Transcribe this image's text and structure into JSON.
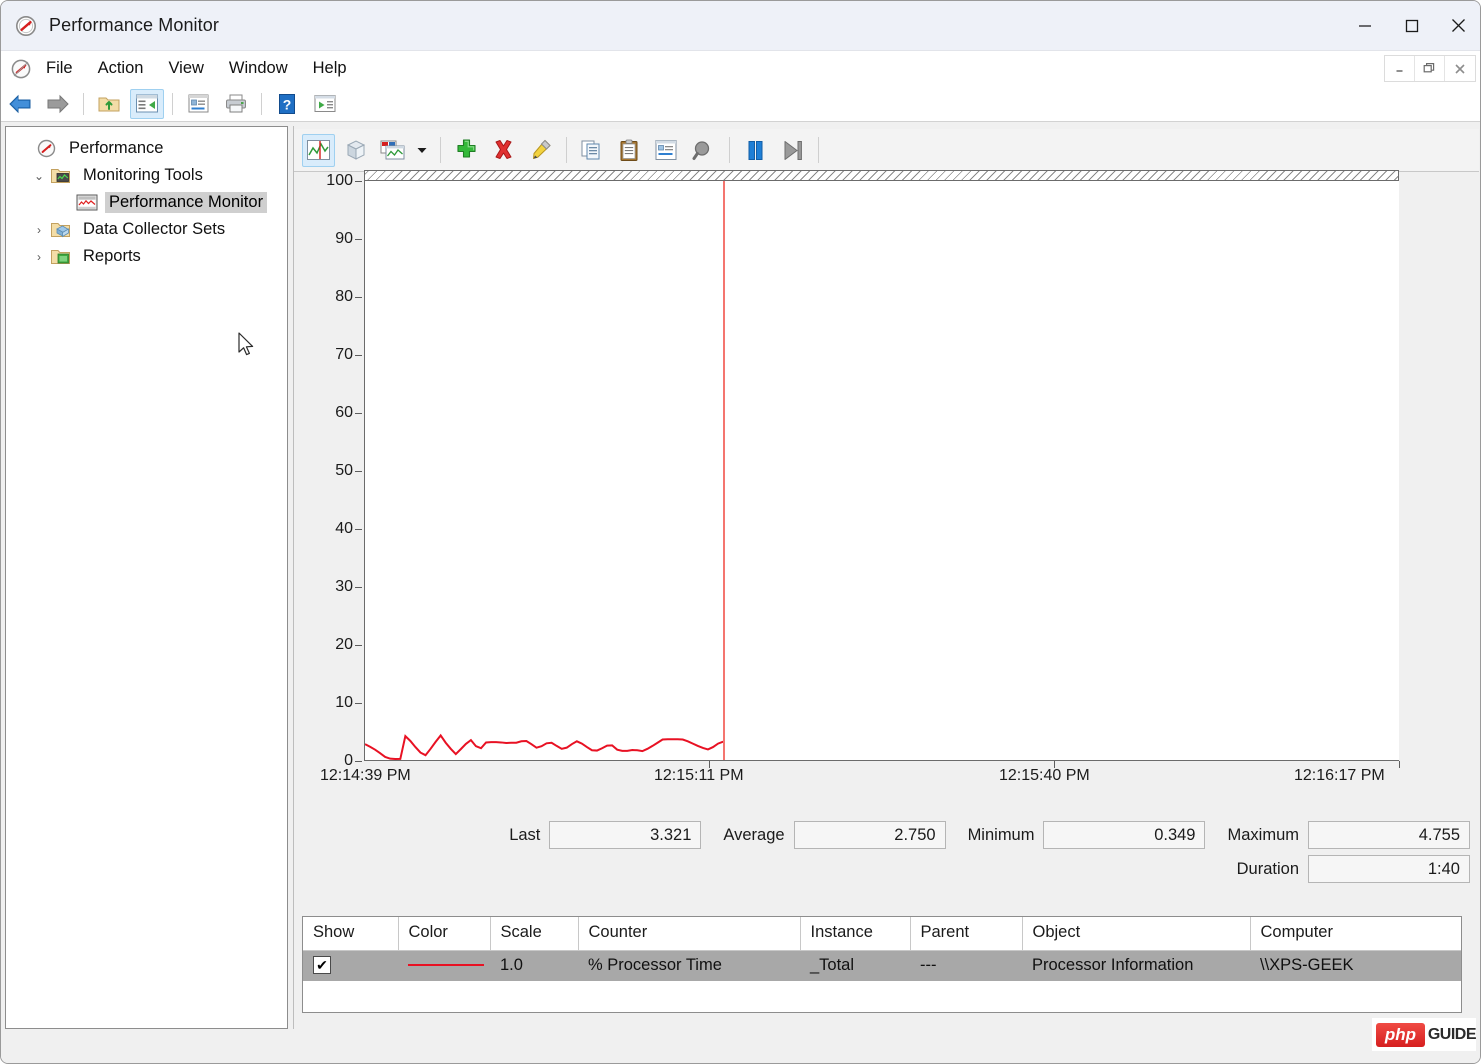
{
  "window": {
    "title": "Performance Monitor",
    "app_icon": "performance-monitor-icon",
    "minimize": "—",
    "maximize": "☐",
    "close": "✕"
  },
  "mdi_controls": {
    "restore_down": "—",
    "restore": "❐",
    "close": "✕"
  },
  "menu": {
    "items": [
      {
        "label": "File"
      },
      {
        "label": "Action"
      },
      {
        "label": "View"
      },
      {
        "label": "Window"
      },
      {
        "label": "Help"
      }
    ]
  },
  "toolbar": {
    "buttons": [
      {
        "name": "back-icon",
        "tooltip": "Back"
      },
      {
        "name": "forward-icon",
        "tooltip": "Forward"
      },
      {
        "name": "up-folder-icon",
        "tooltip": "Up One Level"
      },
      {
        "name": "show-hide-console-tree-icon",
        "tooltip": "Show/Hide Console Tree",
        "active": true
      },
      {
        "name": "properties-icon",
        "tooltip": "Properties"
      },
      {
        "name": "print-icon",
        "tooltip": "Print"
      },
      {
        "name": "help-icon",
        "tooltip": "Help"
      },
      {
        "name": "new-window-icon",
        "tooltip": "New Window"
      }
    ]
  },
  "chart_toolbar": {
    "buttons": [
      {
        "name": "view-graph-icon",
        "tooltip": "View Graph",
        "active": true
      },
      {
        "name": "view-histogram-icon",
        "tooltip": "View Histogram"
      },
      {
        "name": "change-graph-type-icon",
        "tooltip": "Change Graph Type"
      },
      {
        "name": "chevron-down-icon",
        "tooltip": "Graph Type Menu"
      },
      {
        "name": "add-counter-icon",
        "tooltip": "Add"
      },
      {
        "name": "delete-counter-icon",
        "tooltip": "Delete"
      },
      {
        "name": "highlight-icon",
        "tooltip": "Highlight"
      },
      {
        "name": "copy-properties-icon",
        "tooltip": "Copy Properties"
      },
      {
        "name": "paste-counter-list-icon",
        "tooltip": "Paste Counter List"
      },
      {
        "name": "properties-icon",
        "tooltip": "Properties"
      },
      {
        "name": "zoom-icon",
        "tooltip": "Zoom To"
      },
      {
        "name": "freeze-display-icon",
        "tooltip": "Freeze Display"
      },
      {
        "name": "update-data-icon",
        "tooltip": "Update Data"
      }
    ]
  },
  "tree": {
    "items": [
      {
        "label": "Performance",
        "level": 0,
        "twisty": "",
        "icon": "performance-root-icon",
        "selected": false
      },
      {
        "label": "Monitoring Tools",
        "level": 1,
        "twisty": "⌄",
        "icon": "monitoring-tools-folder-icon",
        "selected": false
      },
      {
        "label": "Performance Monitor",
        "level": 2,
        "twisty": "",
        "icon": "performance-monitor-node-icon",
        "selected": true
      },
      {
        "label": "Data Collector Sets",
        "level": 1,
        "twisty": "›",
        "icon": "data-collector-sets-folder-icon",
        "selected": false
      },
      {
        "label": "Reports",
        "level": 1,
        "twisty": "›",
        "icon": "reports-folder-icon",
        "selected": false
      }
    ]
  },
  "stats": {
    "last_label": "Last",
    "last_value": "3.321",
    "average_label": "Average",
    "average_value": "2.750",
    "minimum_label": "Minimum",
    "minimum_value": "0.349",
    "maximum_label": "Maximum",
    "maximum_value": "4.755",
    "duration_label": "Duration",
    "duration_value": "1:40"
  },
  "legend": {
    "columns": [
      "Show",
      "Color",
      "Scale",
      "Counter",
      "Instance",
      "Parent",
      "Object",
      "Computer"
    ],
    "rows": [
      {
        "show": "✔",
        "color": "#e81123",
        "scale": "1.0",
        "counter": "% Processor Time",
        "instance": "_Total",
        "parent": "---",
        "object": "Processor Information",
        "computer": "\\\\XPS-GEEK"
      }
    ]
  },
  "watermark": {
    "logo_text": "php",
    "word": "GUIDE"
  },
  "chart_data": {
    "type": "line",
    "title": "% Processor Time",
    "xlabel": "",
    "ylabel": "",
    "ylim": [
      0,
      100
    ],
    "yticks": [
      0,
      10,
      20,
      30,
      40,
      50,
      60,
      70,
      80,
      90,
      100
    ],
    "grid": false,
    "legend_position": "bottom-table",
    "x_tick_labels": [
      "12:14:39 PM",
      "12:15:11 PM",
      "12:15:40 PM",
      "12:16:17 PM"
    ],
    "cursor_position_fraction": 0.346,
    "series": [
      {
        "name": "% Processor Time",
        "color": "#e81123",
        "units": "percent",
        "values": [
          2.9,
          2.45,
          1.95,
          1.35,
          0.7,
          0.4,
          0.35,
          0.36,
          4.3,
          3.45,
          2.4,
          1.45,
          1.0,
          2.1,
          3.3,
          4.4,
          3.15,
          2.1,
          1.2,
          2.05,
          2.95,
          3.6,
          2.55,
          2.2,
          3.2,
          3.25,
          3.25,
          3.2,
          3.1,
          3.15,
          3.15,
          3.4,
          3.45,
          2.9,
          2.3,
          2.55,
          3.05,
          3.15,
          2.6,
          2.1,
          2.3,
          2.9,
          3.4,
          3.0,
          2.4,
          1.85,
          1.8,
          2.2,
          2.65,
          2.7,
          1.95,
          1.75,
          1.75,
          1.9,
          1.85,
          1.7,
          2.1,
          2.6,
          3.15,
          3.7,
          3.75,
          3.75,
          3.75,
          3.7,
          3.4,
          3.0,
          2.6,
          2.25,
          2.0,
          2.4,
          3.0,
          3.32
        ]
      }
    ]
  }
}
